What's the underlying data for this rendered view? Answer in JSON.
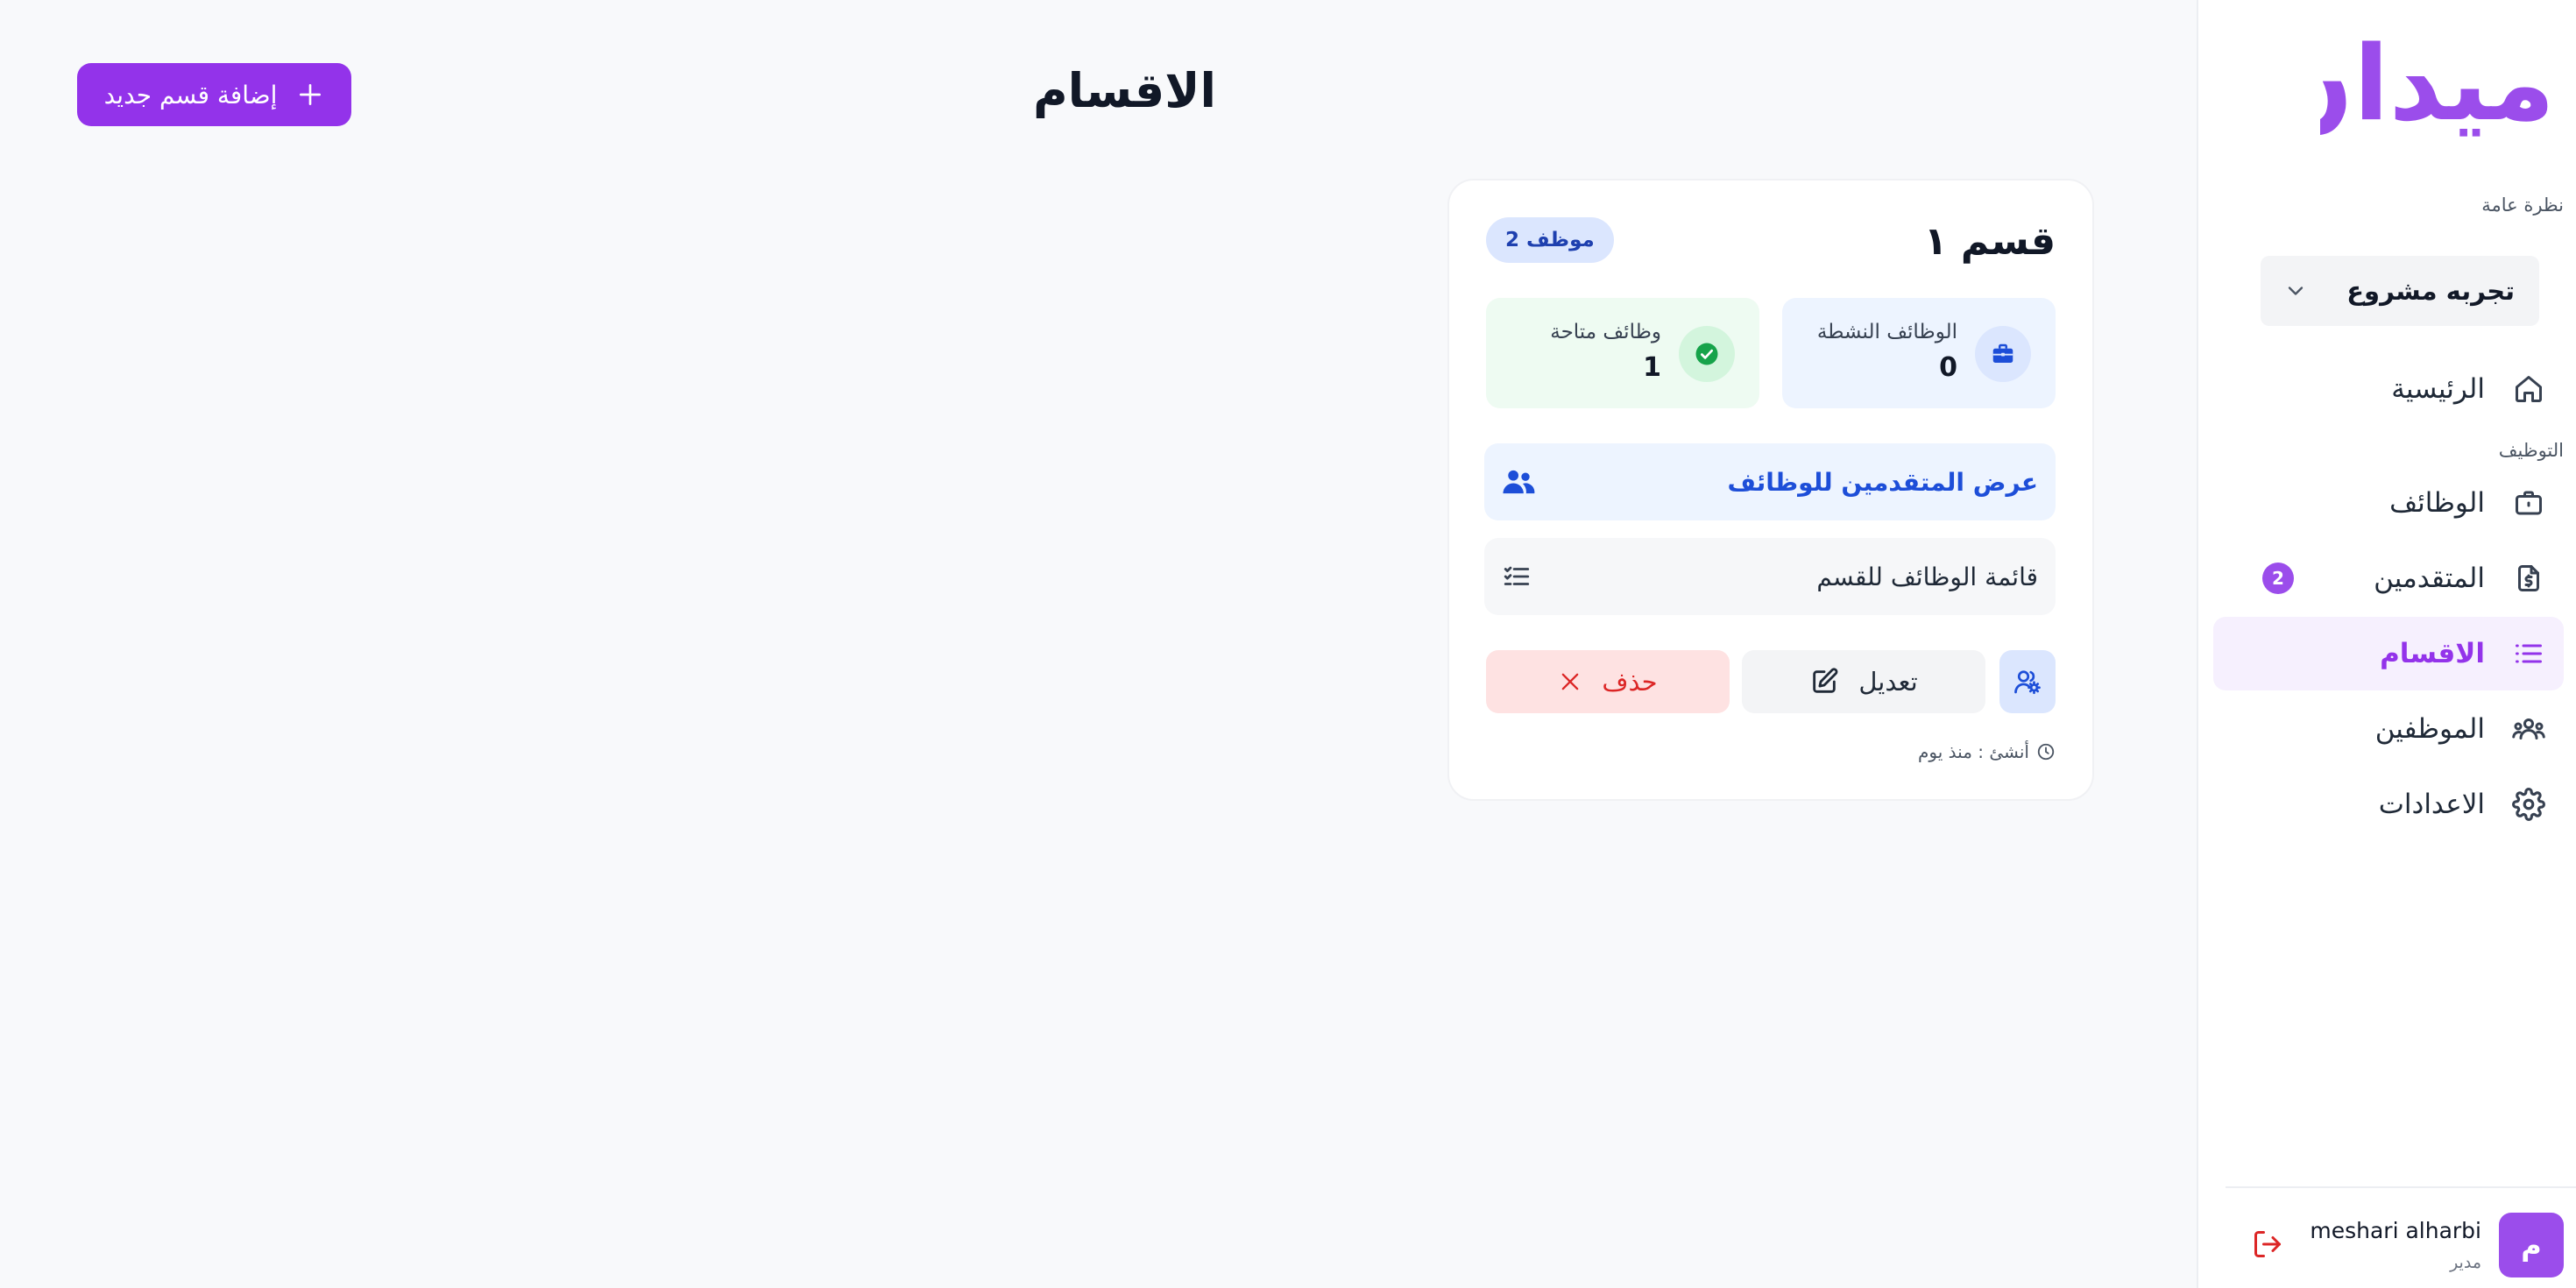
{
  "sidebar": {
    "logo_text": "ميدان",
    "overview_label": "نظرة عامة",
    "project_select": {
      "value": "تجربه مشروع"
    },
    "items": [
      {
        "label": "الرئيسية",
        "icon": "home-icon"
      },
      {
        "label": "الوظائف",
        "icon": "briefcase-icon"
      },
      {
        "label": "المتقدمين",
        "icon": "file-dollar-icon",
        "badge": "2"
      },
      {
        "label": "الاقسام",
        "icon": "list-icon",
        "active": true
      },
      {
        "label": "الموظفين",
        "icon": "users-icon"
      },
      {
        "label": "الاعدادات",
        "icon": "gear-icon"
      }
    ],
    "recruitment_label": "التوظيف",
    "user": {
      "avatar_letter": "م",
      "name": "meshari alharbi",
      "role": "مدير"
    }
  },
  "main": {
    "title": "الاقسام",
    "add_button_label": "إضافة قسم جديد"
  },
  "department_card": {
    "title": "قسم ١",
    "employees_badge": "2 موظف",
    "stats": {
      "active_jobs": {
        "label": "الوظائف النشطة",
        "value": "0"
      },
      "available_jobs": {
        "label": "وظائف متاحة",
        "value": "1"
      }
    },
    "view_applicants_label": "عرض المتقدمين للوظائف",
    "jobs_list_label": "قائمة الوظائف للقسم",
    "edit_label": "تعديل",
    "delete_label": "حذف",
    "created_text": "أنشئ : منذ يوم"
  },
  "colors": {
    "brand": "#9333ea",
    "logo": "#9b4deb",
    "blue": "#1d4ed8",
    "green": "#16a34a",
    "danger": "#dc2626"
  }
}
